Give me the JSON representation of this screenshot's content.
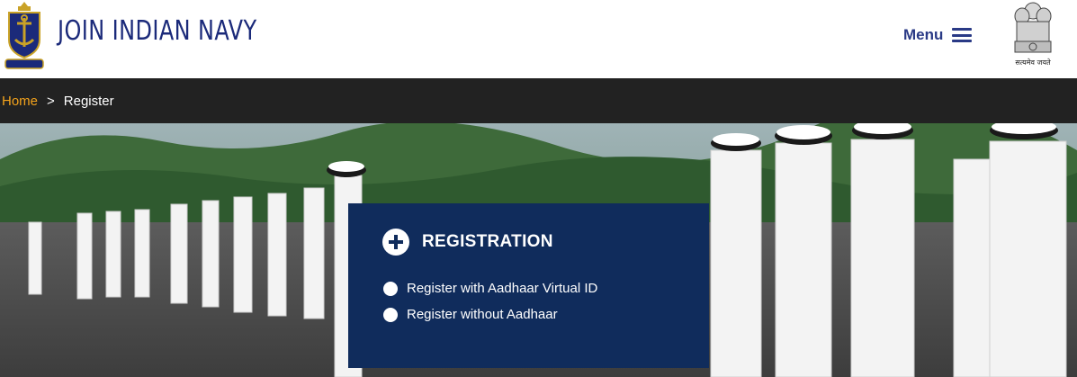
{
  "header": {
    "site_title": "JOIN INDIAN NAVY",
    "logo_icon": "navy-crest-icon",
    "menu_label": "Menu",
    "menu_icon": "hamburger-icon",
    "emblem_icon": "national-emblem-icon",
    "emblem_motto": "सत्यमेव जयते"
  },
  "breadcrumb": {
    "home": "Home",
    "separator": ">",
    "current": "Register"
  },
  "registration": {
    "title": "REGISTRATION",
    "icon": "plus-circle-icon",
    "options": [
      {
        "label": "Register with Aadhaar Virtual ID"
      },
      {
        "label": "Register without Aadhaar"
      }
    ]
  },
  "colors": {
    "title_blue": "#1b2a7a",
    "breadcrumb_bg": "#222222",
    "breadcrumb_link": "#f2a21c",
    "panel_bg": "#102c5c"
  }
}
